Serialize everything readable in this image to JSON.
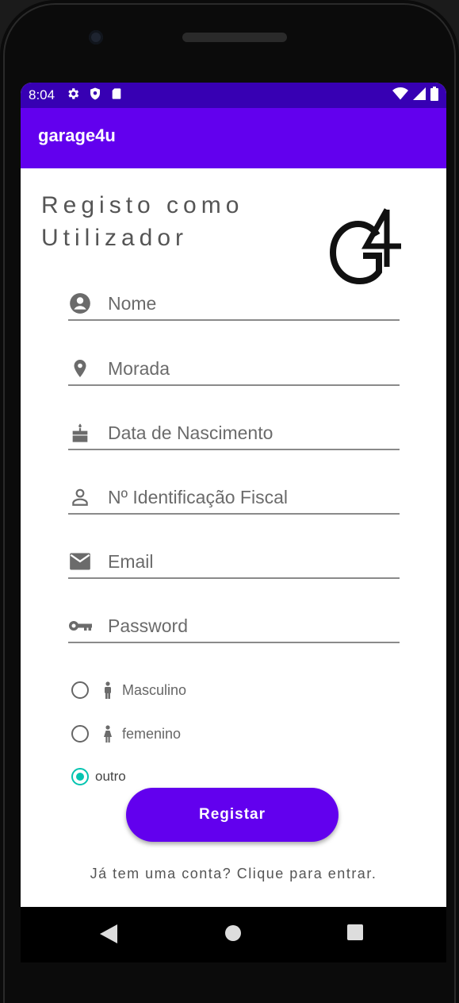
{
  "status_bar": {
    "time": "8:04",
    "left_icons": [
      "gear-icon",
      "shield-icon",
      "sd-card-icon"
    ],
    "right_icons": [
      "wifi-icon",
      "signal-icon",
      "battery-icon"
    ]
  },
  "app_bar": {
    "title": "garage4u"
  },
  "heading": "Registo como\nUtilizador",
  "logo": {
    "text": "G4"
  },
  "fields": [
    {
      "icon": "account-circle-icon",
      "placeholder": "Nome"
    },
    {
      "icon": "location-pin-icon",
      "placeholder": "Morada"
    },
    {
      "icon": "cake-icon",
      "placeholder": "Data de Nascimento"
    },
    {
      "icon": "person-outline-icon",
      "placeholder": "Nº Identificação Fiscal"
    },
    {
      "icon": "email-icon",
      "placeholder": "Email"
    },
    {
      "icon": "key-icon",
      "placeholder": "Password"
    }
  ],
  "gender_options": [
    {
      "icon": "male-icon",
      "label": "Masculino",
      "selected": false
    },
    {
      "icon": "female-icon",
      "label": "femenino",
      "selected": false
    },
    {
      "icon": "",
      "label": "outro",
      "selected": true
    }
  ],
  "register_button": {
    "label": "Registar"
  },
  "login_link": {
    "text": "Já tem uma conta? Clique para entrar."
  },
  "nav_bar": [
    "back-icon",
    "home-icon",
    "recents-icon"
  ],
  "colors": {
    "status_bar": "#3700b3",
    "app_bar": "#6200ee",
    "button": "#6200ee",
    "radio_selected": "#03c4b0"
  }
}
